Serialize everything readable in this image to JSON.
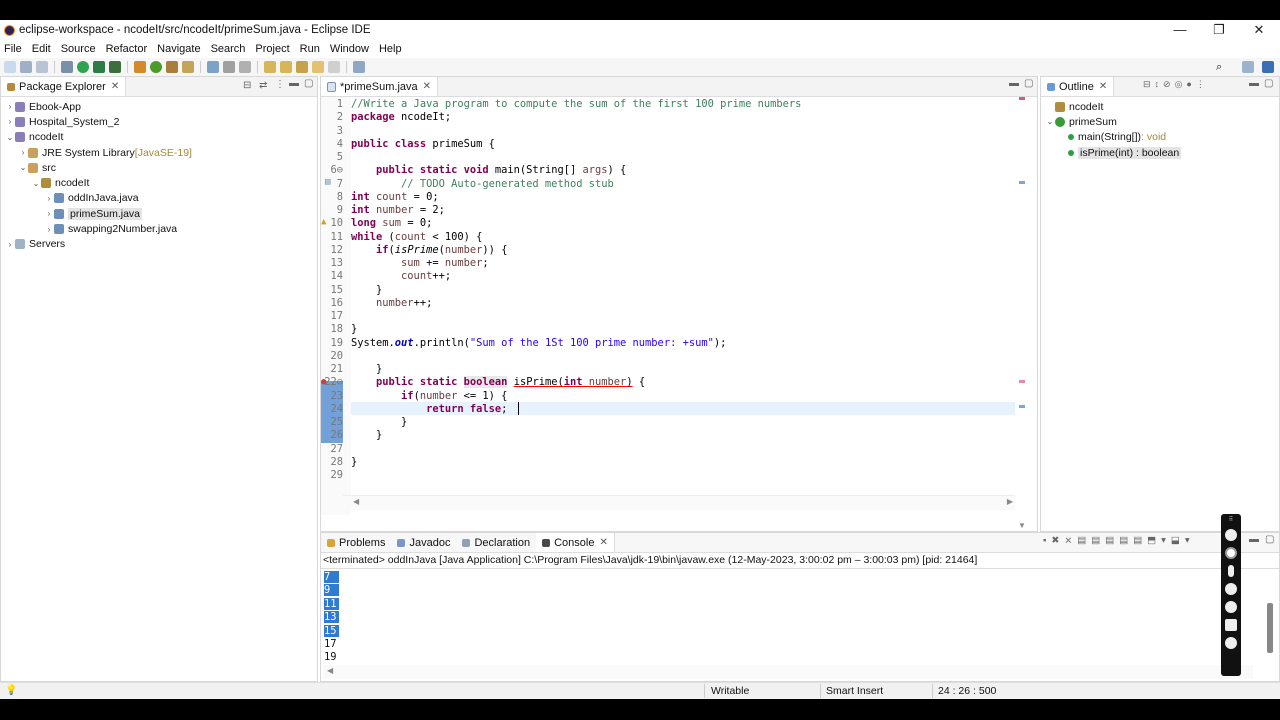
{
  "window": {
    "title": "eclipse-workspace - ncodeIt/src/ncodeIt/primeSum.java - Eclipse IDE",
    "controls": [
      "—",
      "❐",
      "✕"
    ]
  },
  "menu": [
    "File",
    "Edit",
    "Source",
    "Refactor",
    "Navigate",
    "Search",
    "Project",
    "Run",
    "Window",
    "Help"
  ],
  "package_explorer": {
    "tab": "Package Explorer",
    "items": [
      {
        "label": "Ebook-App",
        "indent": 0,
        "twisty": "›",
        "icon": "project-icon"
      },
      {
        "label": "Hospital_System_2",
        "indent": 0,
        "twisty": "›",
        "icon": "project-icon"
      },
      {
        "label": "ncodeIt",
        "indent": 0,
        "twisty": "⌄",
        "icon": "project-icon"
      },
      {
        "label": "JRE System Library",
        "extra": "[JavaSE-19]",
        "indent": 1,
        "twisty": "›",
        "icon": "library-icon"
      },
      {
        "label": "src",
        "indent": 1,
        "twisty": "⌄",
        "icon": "source-folder-icon"
      },
      {
        "label": "ncodeIt",
        "indent": 2,
        "twisty": "⌄",
        "icon": "package-icon"
      },
      {
        "label": "oddInJava.java",
        "indent": 3,
        "twisty": "›",
        "icon": "java-file-icon"
      },
      {
        "label": "primeSum.java",
        "indent": 3,
        "twisty": "›",
        "icon": "java-file-icon",
        "selected": true
      },
      {
        "label": "swapping2Number.java",
        "indent": 3,
        "twisty": "›",
        "icon": "java-file-icon"
      },
      {
        "label": "Servers",
        "indent": 0,
        "twisty": "›",
        "icon": "folder-icon"
      }
    ]
  },
  "editor": {
    "tab": "*primeSum.java",
    "lines": [
      {
        "n": "1",
        "html": "<span class='cm'>//Write a Java program to compute the sum of the first 100 prime numbers</span>"
      },
      {
        "n": "2",
        "html": "<span class='kw'>package</span> ncodeIt;"
      },
      {
        "n": "3",
        "html": ""
      },
      {
        "n": "4",
        "html": "<span class='kw'>public class</span> primeSum {"
      },
      {
        "n": "5",
        "html": ""
      },
      {
        "n": "6⊖",
        "html": "    <span class='kw'>public static void</span> main(String[] <span class='var'>args</span>) {"
      },
      {
        "n": "7",
        "html": "        <span class='cm'>// TODO Auto-generated method stub</span>"
      },
      {
        "n": "8",
        "html": "<span class='kw'>int</span> <span class='var'>count</span> = 0;"
      },
      {
        "n": "9",
        "html": "<span class='kw'>int</span> <span class='var'>number</span> = 2;"
      },
      {
        "n": "10",
        "html": "<span class='kw'>long</span> <span class='var'>sum</span> = 0;"
      },
      {
        "n": "11",
        "html": "<span class='kw'>while</span> (<span class='var'>count</span> < 100) {"
      },
      {
        "n": "12",
        "html": "    <span class='kw'>if</span>(<span class='it'>isPrime</span>(<span class='var'>number</span>)) {"
      },
      {
        "n": "13",
        "html": "        <span class='var'>sum</span> += <span class='var'>number</span>;"
      },
      {
        "n": "14",
        "html": "        <span class='var'>count</span>++;"
      },
      {
        "n": "15",
        "html": "    }"
      },
      {
        "n": "16",
        "html": "    <span class='var'>number</span>++;"
      },
      {
        "n": "17",
        "html": ""
      },
      {
        "n": "18",
        "html": "}"
      },
      {
        "n": "19",
        "html": "System.<span class='fld'>out</span>.println(<span class='st'>\"Sum of the 1St 100 prime number: +sum\"</span>);"
      },
      {
        "n": "20",
        "html": ""
      },
      {
        "n": "21",
        "html": "    }"
      },
      {
        "n": "22⊖",
        "html": "    <span class='kw'>public static</span> <span class='kw' style='background:#e8e8e8'>boolean</span> <u style='text-decoration-color:red'>isPrime(<span class='kw'>int</span> <span class='var'>number</span>)</u> {"
      },
      {
        "n": "23",
        "html": "        <span class='kw'>if</span>(<span class='var'>number</span> <= 1) {"
      },
      {
        "n": "24",
        "html": "            <span class='kw'>return false</span>;"
      },
      {
        "n": "25",
        "html": "        }"
      },
      {
        "n": "26",
        "html": "    }"
      },
      {
        "n": "27",
        "html": ""
      },
      {
        "n": "28",
        "html": "}"
      },
      {
        "n": "29",
        "html": ""
      }
    ]
  },
  "outline": {
    "tab": "Outline",
    "items": [
      {
        "label": "ncodeIt",
        "indent": 0,
        "twisty": "",
        "icon": "package-icon"
      },
      {
        "label": "primeSum",
        "indent": 0,
        "twisty": "⌄",
        "icon": "class-icon"
      },
      {
        "label": "main(String[])",
        "suffix": " : void",
        "indent": 1,
        "twisty": "",
        "icon": "method-icon"
      },
      {
        "label": "isPrime(int) : boolean",
        "suffix": "",
        "indent": 1,
        "twisty": "",
        "icon": "method-icon",
        "selected": true
      }
    ]
  },
  "bottom": {
    "tabs": [
      {
        "label": "Problems",
        "icon": "problems-icon"
      },
      {
        "label": "Javadoc",
        "icon": "javadoc-icon"
      },
      {
        "label": "Declaration",
        "icon": "declaration-icon"
      },
      {
        "label": "Console",
        "icon": "console-icon",
        "active": true
      }
    ],
    "console_header": "<terminated> oddInJava [Java Application] C:\\Program Files\\Java\\jdk-19\\bin\\javaw.exe  (12-May-2023, 3:00:02 pm – 3:00:03 pm) [pid: 21464]",
    "output": [
      {
        "text": "7",
        "selected": true
      },
      {
        "text": "9",
        "selected": true
      },
      {
        "text": "11",
        "selected": true
      },
      {
        "text": "13",
        "selected": true
      },
      {
        "text": "15",
        "selected": true
      },
      {
        "text": "17",
        "selected": false
      },
      {
        "text": "19",
        "selected": false
      }
    ]
  },
  "status": {
    "writable": "Writable",
    "insert_mode": "Smart Insert",
    "position": "24 : 26 : 500"
  },
  "colors": {
    "selection": "#2e7bd1",
    "keyword": "#7f0055",
    "comment": "#3f7f5f",
    "string": "#2a00ff",
    "current_line": "#e8f2fe"
  }
}
